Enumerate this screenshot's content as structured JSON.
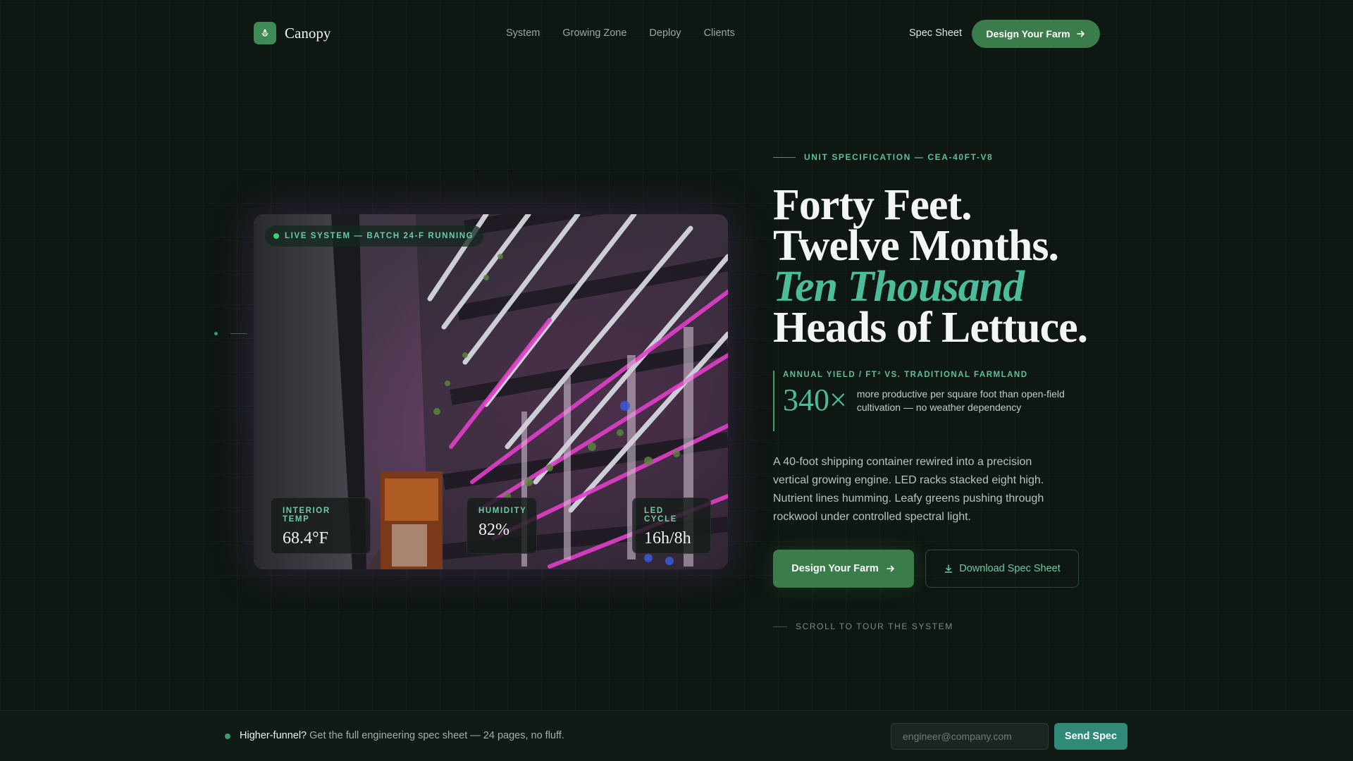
{
  "nav": {
    "brand": "Canopy",
    "links": [
      "System",
      "Growing Zone",
      "Deploy",
      "Clients"
    ],
    "spec_sheet": "Spec Sheet",
    "cta": "Design Your Farm"
  },
  "hero_image": {
    "live_badge": "LIVE SYSTEM — BATCH 24-F RUNNING",
    "stats": [
      {
        "label": "INTERIOR TEMP",
        "value": "68.4°F"
      },
      {
        "label": "HUMIDITY",
        "value": "82%"
      },
      {
        "label": "LED CYCLE",
        "value": "16h/8h"
      }
    ]
  },
  "content": {
    "eyebrow": "UNIT SPECIFICATION — CEA-40FT-V8",
    "headline": {
      "line1": "Forty Feet.",
      "line2": "Twelve Months.",
      "line3_accent": "Ten Thousand",
      "line4": "Heads of Lettuce."
    },
    "yield": {
      "label": "ANNUAL YIELD / FT² VS. TRADITIONAL FARMLAND",
      "value": "340×",
      "description": "more productive per square foot than open-field cultivation — no weather dependency"
    },
    "body": "A 40-foot shipping container rewired into a precision vertical growing engine. LED racks stacked eight high. Nutrient lines humming. Leafy greens pushing through rockwool under controlled spectral light.",
    "primary_cta": "Design Your Farm",
    "secondary_cta": "Download Spec Sheet",
    "scroll_hint": "SCROLL TO TOUR THE SYSTEM"
  },
  "bottom_bar": {
    "lead": "Higher-funnel?",
    "text": "Get the full engineering spec sheet — 24 pages, no fluff.",
    "email_placeholder": "engineer@company.com",
    "submit": "Send Spec"
  },
  "colors": {
    "background": "#0e1712",
    "accent_green": "#3a7d4a",
    "accent_teal": "#4cbc9a",
    "led_pink": "#e040c8"
  },
  "icons": {
    "brand": "leaf-icon",
    "cta": "arrow-right-icon",
    "download": "download-icon"
  }
}
